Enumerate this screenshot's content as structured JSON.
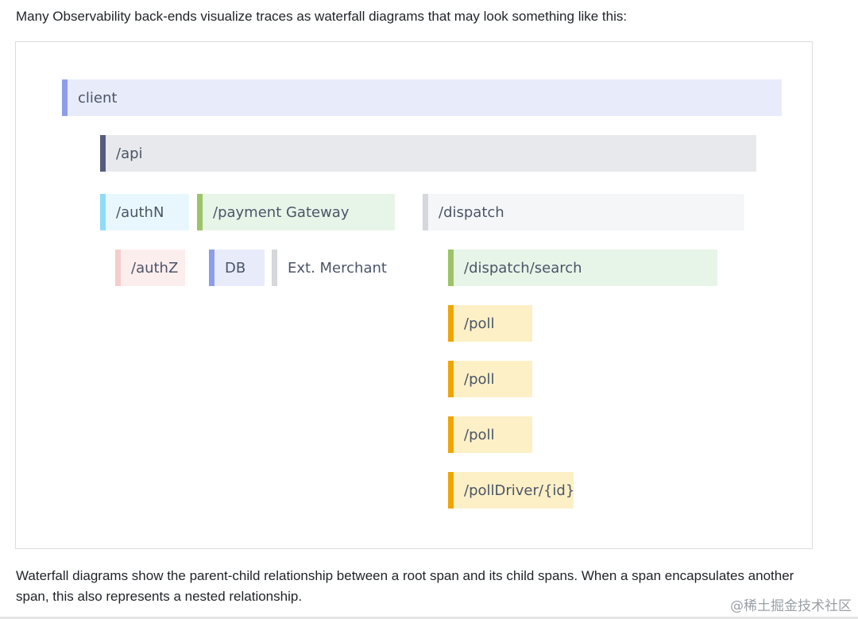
{
  "intro_text": "Many Observability back-ends visualize traces as waterfall diagrams that may look something like this:",
  "outro_text": "Waterfall diagrams show the parent-child relationship between a root span and its child spans. When a span encapsulates another span, this also represents a nested relationship.",
  "watermark": "@稀土掘金技术社区",
  "colors": {
    "periwinkle": "#8d9ee8",
    "periwinkle_bg": "#e8ebfa",
    "slate": "#555d7b",
    "slate_bg": "#e8e9ed",
    "sky": "#8fdcf8",
    "sky_bg": "#e8f7fd",
    "green": "#9cc466",
    "green_bg": "#e7f4e8",
    "gray": "#d5d7dc",
    "gray_bg": "#f5f6f8",
    "pink": "#f6cccc",
    "pink_bg": "#fdeeee",
    "white_bg": "#ffffff",
    "amber": "#f0a500",
    "amber_bg": "#fdf0c6"
  },
  "spans": [
    {
      "label": "client",
      "name": "span-client",
      "accent": "periwinkle",
      "fill": "periwinkle_bg"
    },
    {
      "label": "/api",
      "name": "span-api",
      "accent": "slate",
      "fill": "slate_bg"
    },
    {
      "label": "/authN",
      "name": "span-authn",
      "accent": "sky",
      "fill": "sky_bg"
    },
    {
      "label": "/payment Gateway",
      "name": "span-payment-gateway",
      "accent": "green",
      "fill": "green_bg"
    },
    {
      "label": "/dispatch",
      "name": "span-dispatch",
      "accent": "gray",
      "fill": "gray_bg"
    },
    {
      "label": "/authZ",
      "name": "span-authz",
      "accent": "pink",
      "fill": "pink_bg"
    },
    {
      "label": "DB",
      "name": "span-db",
      "accent": "periwinkle",
      "fill": "periwinkle_bg"
    },
    {
      "label": "Ext. Merchant",
      "name": "span-ext-merchant",
      "accent": "gray",
      "fill": "white_bg"
    },
    {
      "label": "/dispatch/search",
      "name": "span-dispatch-search",
      "accent": "green",
      "fill": "green_bg"
    },
    {
      "label": "/poll",
      "name": "span-poll-1",
      "accent": "amber",
      "fill": "amber_bg"
    },
    {
      "label": "/poll",
      "name": "span-poll-2",
      "accent": "amber",
      "fill": "amber_bg"
    },
    {
      "label": "/poll",
      "name": "span-poll-3",
      "accent": "amber",
      "fill": "amber_bg"
    },
    {
      "label": "/pollDriver/{id}",
      "name": "span-polldriver",
      "accent": "amber",
      "fill": "amber_bg"
    }
  ]
}
